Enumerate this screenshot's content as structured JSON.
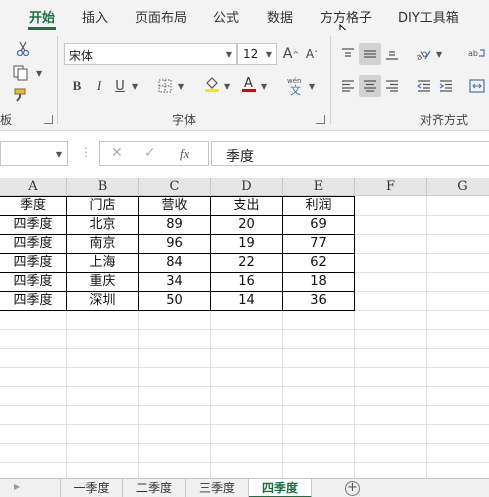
{
  "ribbon_tabs": [
    "开始",
    "插入",
    "页面布局",
    "公式",
    "数据",
    "方方格子",
    "DIY工具箱"
  ],
  "font": {
    "name": "宋体",
    "size": "12",
    "group_label": "字体"
  },
  "alignment": {
    "group_label": "对齐方式"
  },
  "clipboard": {
    "group_label_partial": "板"
  },
  "formula_bar": {
    "name_box": "",
    "fx_symbol": "fx",
    "content": "季度"
  },
  "columns": [
    "A",
    "B",
    "C",
    "D",
    "E",
    "F",
    "G"
  ],
  "table": {
    "headers": [
      "季度",
      "门店",
      "营收",
      "支出",
      "利润"
    ],
    "rows": [
      [
        "四季度",
        "北京",
        "89",
        "20",
        "69"
      ],
      [
        "四季度",
        "南京",
        "96",
        "19",
        "77"
      ],
      [
        "四季度",
        "上海",
        "84",
        "22",
        "62"
      ],
      [
        "四季度",
        "重庆",
        "34",
        "16",
        "18"
      ],
      [
        "四季度",
        "深圳",
        "50",
        "14",
        "36"
      ]
    ]
  },
  "sheets": [
    "一季度",
    "二季度",
    "三季度",
    "四季度"
  ],
  "active_sheet": "四季度",
  "colors": {
    "accent": "#1d6f42",
    "highlight_yellow": "#ffe600",
    "font_red": "#e60000"
  }
}
